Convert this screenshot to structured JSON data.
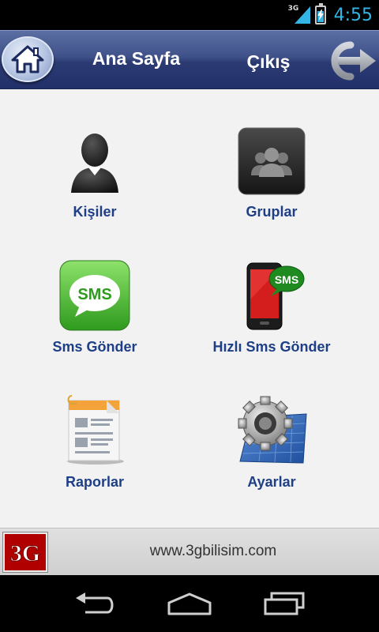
{
  "status_bar": {
    "network": "3G",
    "time": "4:55",
    "icons": [
      "signal-icon",
      "battery-charging-icon"
    ]
  },
  "header": {
    "title": "Ana Sayfa",
    "exit_label": "Çıkış",
    "icons": [
      "home-icon",
      "exit-icon"
    ]
  },
  "menu": {
    "items": [
      {
        "label": "Kişiler",
        "icon": "person-icon"
      },
      {
        "label": "Gruplar",
        "icon": "group-icon"
      },
      {
        "label": "Sms Gönder",
        "icon": "sms-bubble-icon"
      },
      {
        "label": "Hızlı Sms Gönder",
        "icon": "phone-sms-icon"
      },
      {
        "label": "Raporlar",
        "icon": "report-icon"
      },
      {
        "label": "Ayarlar",
        "icon": "settings-gear-icon"
      }
    ]
  },
  "footer": {
    "logo_text": "3G",
    "url": "www.3gbilisim.com"
  },
  "nav_bar": {
    "icons": [
      "back-icon",
      "home-nav-icon",
      "recent-apps-icon"
    ]
  },
  "colors": {
    "header_blue": "#2b3b72",
    "label_blue": "#1e3f86",
    "status_accent": "#33b5e5",
    "content_bg": "#f2f2f2"
  }
}
